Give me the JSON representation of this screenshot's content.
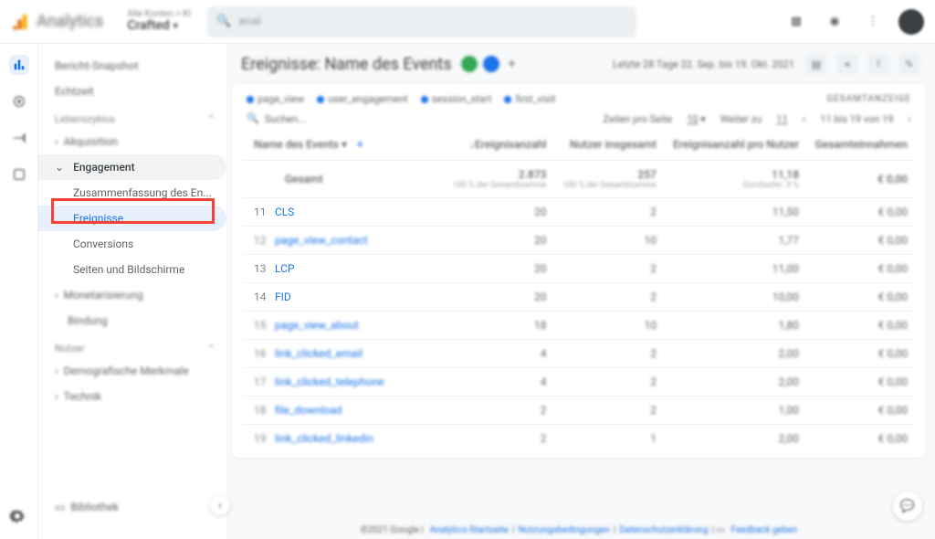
{
  "header": {
    "brand": "Analytics",
    "property_group": "Alle Konten > KI",
    "property_name": "Crafted",
    "search_placeholder": "anal",
    "date_label": "Letzte 28 Tage  22. Sep. bis 19. Okt. 2021"
  },
  "report": {
    "title": "Ereignisse: Name des Events",
    "compare_label": "GESAMTANZEIGE"
  },
  "sidebar": {
    "items": [
      {
        "label": "Bericht-Snapshot"
      },
      {
        "label": "Echtzeit"
      }
    ],
    "section_lifecycle": "Lebenszyklus",
    "life_items": [
      {
        "label": "Akquisition"
      },
      {
        "label": "Engagement"
      }
    ],
    "engagement_children": [
      {
        "label": "Zusammenfassung des En..."
      },
      {
        "label": "Ereignisse"
      },
      {
        "label": "Conversions"
      },
      {
        "label": "Seiten und Bildschirme"
      }
    ],
    "life_tail": [
      {
        "label": "Monetarisierung"
      },
      {
        "label": "Bindung"
      }
    ],
    "section_user": "Nutzer",
    "user_items": [
      {
        "label": "Demografische Merkmale"
      },
      {
        "label": "Technik"
      }
    ],
    "library": "Bibliothek"
  },
  "legend": {
    "items": [
      "page_view",
      "user_engagement",
      "session_start",
      "first_visit"
    ]
  },
  "controls": {
    "search": "Suchen...",
    "rows_label": "Zeilen pro Seite",
    "rows_value": "10",
    "goto_label": "Weiter zu",
    "goto_value": "11",
    "range": "11 bis 19 von 19"
  },
  "table": {
    "columns": [
      "Name des Events",
      "↓Ereignisanzahl",
      "Nutzer insgesamt",
      "Ereignisanzahl pro Nutzer",
      "Gesamteinnahmen"
    ],
    "total": {
      "label": "Gesamt",
      "ereignisanzahl": "2.873",
      "ereignisanzahl_sub": "100 % der Gesamtsumme",
      "nutzer": "257",
      "nutzer_sub": "100 % der Gesamtsumme",
      "pro": "11,18",
      "pro_sub": "Durchschn. 0 %",
      "einnahmen": "€ 0,00"
    },
    "rows": [
      {
        "idx": "11",
        "name": "CLS",
        "c1": "20",
        "c2": "2",
        "c3": "11,50",
        "c4": "€ 0,00",
        "sharp": true
      },
      {
        "idx": "12",
        "name": "page_view_contact",
        "c1": "20",
        "c2": "10",
        "c3": "1,77",
        "c4": "€ 0,00",
        "sharp": false
      },
      {
        "idx": "13",
        "name": "LCP",
        "c1": "20",
        "c2": "2",
        "c3": "11,00",
        "c4": "€ 0,00",
        "sharp": true
      },
      {
        "idx": "14",
        "name": "FID",
        "c1": "20",
        "c2": "2",
        "c3": "10,00",
        "c4": "€ 0,00",
        "sharp": true
      },
      {
        "idx": "15",
        "name": "page_view_about",
        "c1": "18",
        "c2": "10",
        "c3": "1,80",
        "c4": "€ 0,00",
        "sharp": false
      },
      {
        "idx": "16",
        "name": "link_clicked_email",
        "c1": "4",
        "c2": "2",
        "c3": "2,00",
        "c4": "€ 0,00",
        "sharp": false
      },
      {
        "idx": "17",
        "name": "link_clicked_telephone",
        "c1": "4",
        "c2": "2",
        "c3": "2,00",
        "c4": "€ 0,00",
        "sharp": false
      },
      {
        "idx": "18",
        "name": "file_download",
        "c1": "2",
        "c2": "2",
        "c3": "1,00",
        "c4": "€ 0,00",
        "sharp": false
      },
      {
        "idx": "19",
        "name": "link_clicked_linkedin",
        "c1": "2",
        "c2": "1",
        "c3": "2,00",
        "c4": "€ 0,00",
        "sharp": false
      }
    ]
  },
  "footer": {
    "copyright": "©2021 Google",
    "links": [
      "Analytics-Startseite",
      "Nutzungsbedingungen",
      "Datenschutzerklärung",
      "Feedback geben"
    ]
  }
}
